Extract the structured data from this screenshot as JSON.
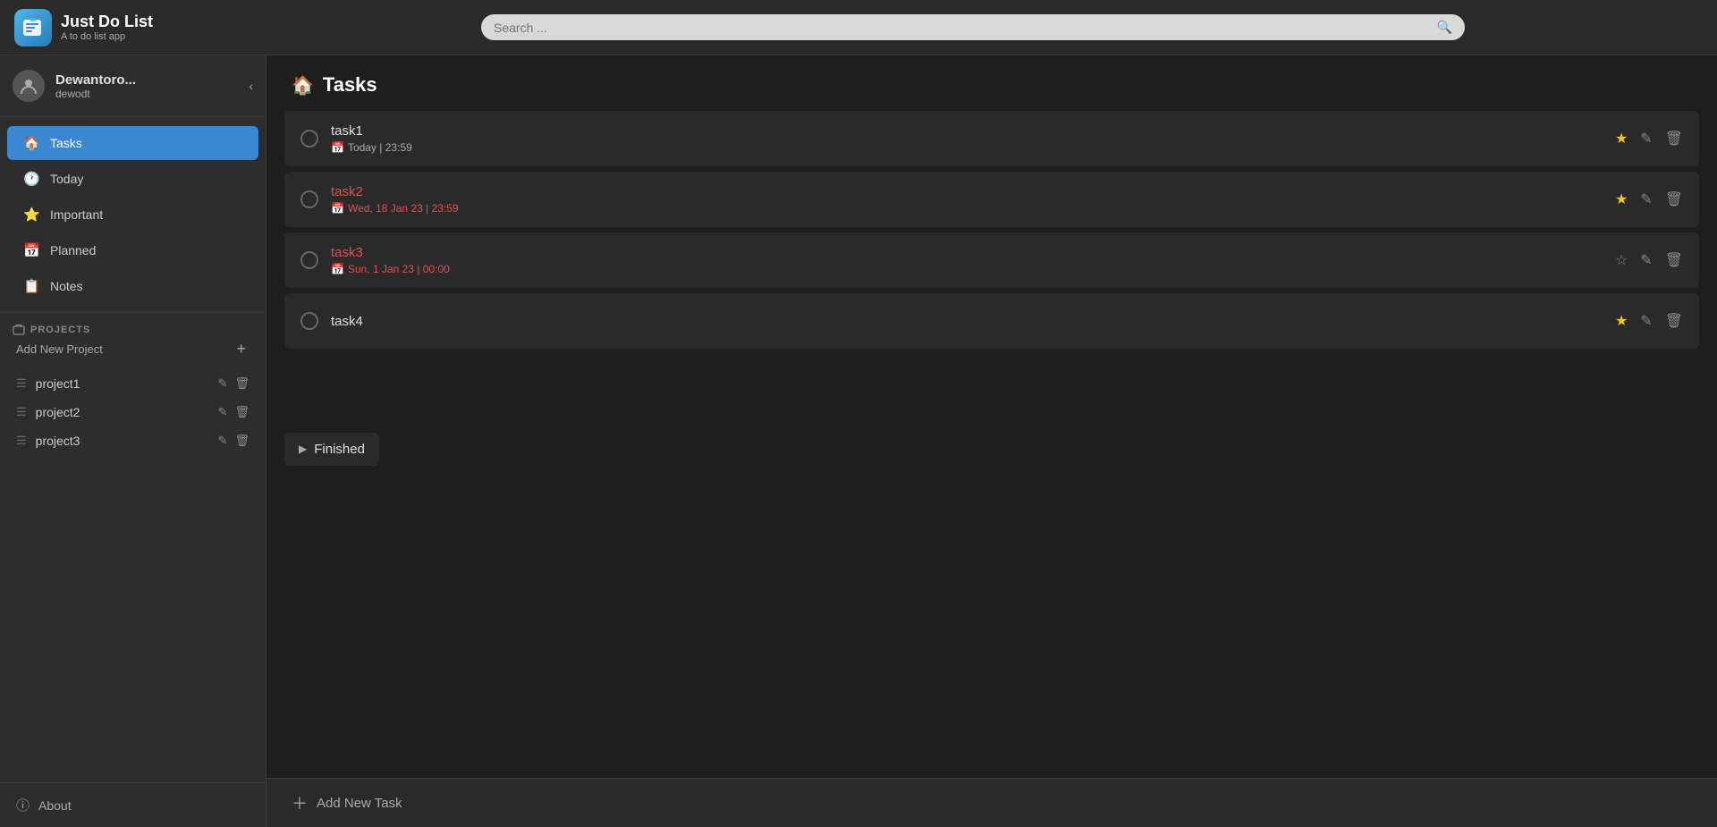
{
  "app": {
    "title": "Just Do List",
    "subtitle": "A to do list app",
    "logo_emoji": "📋"
  },
  "search": {
    "placeholder": "Search ..."
  },
  "user": {
    "name": "Dewantoro...",
    "handle": "dewodt",
    "avatar_icon": "👤"
  },
  "nav": {
    "items": [
      {
        "id": "tasks",
        "label": "Tasks",
        "icon": "🏠",
        "active": true
      },
      {
        "id": "today",
        "label": "Today",
        "icon": "🕐",
        "active": false
      },
      {
        "id": "important",
        "label": "Important",
        "icon": "⭐",
        "active": false
      },
      {
        "id": "planned",
        "label": "Planned",
        "icon": "📅",
        "active": false
      },
      {
        "id": "notes",
        "label": "Notes",
        "icon": "📋",
        "active": false
      }
    ]
  },
  "projects": {
    "section_label": "PROJECTS",
    "add_label": "Add New Project",
    "add_icon": "+",
    "items": [
      {
        "id": "project1",
        "name": "project1"
      },
      {
        "id": "project2",
        "name": "project2"
      },
      {
        "id": "project3",
        "name": "project3"
      }
    ]
  },
  "about": {
    "label": "About",
    "icon": "ℹ️"
  },
  "content": {
    "title": "Tasks",
    "home_icon": "🏠",
    "tasks": [
      {
        "id": "task1",
        "name": "task1",
        "due": "Today | 23:59",
        "overdue": false,
        "starred": true,
        "has_due": true
      },
      {
        "id": "task2",
        "name": "task2",
        "due": "Wed, 18 Jan 23 | 23:59",
        "overdue": true,
        "starred": true,
        "has_due": true
      },
      {
        "id": "task3",
        "name": "task3",
        "due": "Sun, 1 Jan 23 | 00:00",
        "overdue": true,
        "starred": false,
        "has_due": true
      },
      {
        "id": "task4",
        "name": "task4",
        "due": "",
        "overdue": false,
        "starred": true,
        "has_due": false
      }
    ],
    "finished_label": "Finished",
    "add_task_label": "Add New Task"
  }
}
